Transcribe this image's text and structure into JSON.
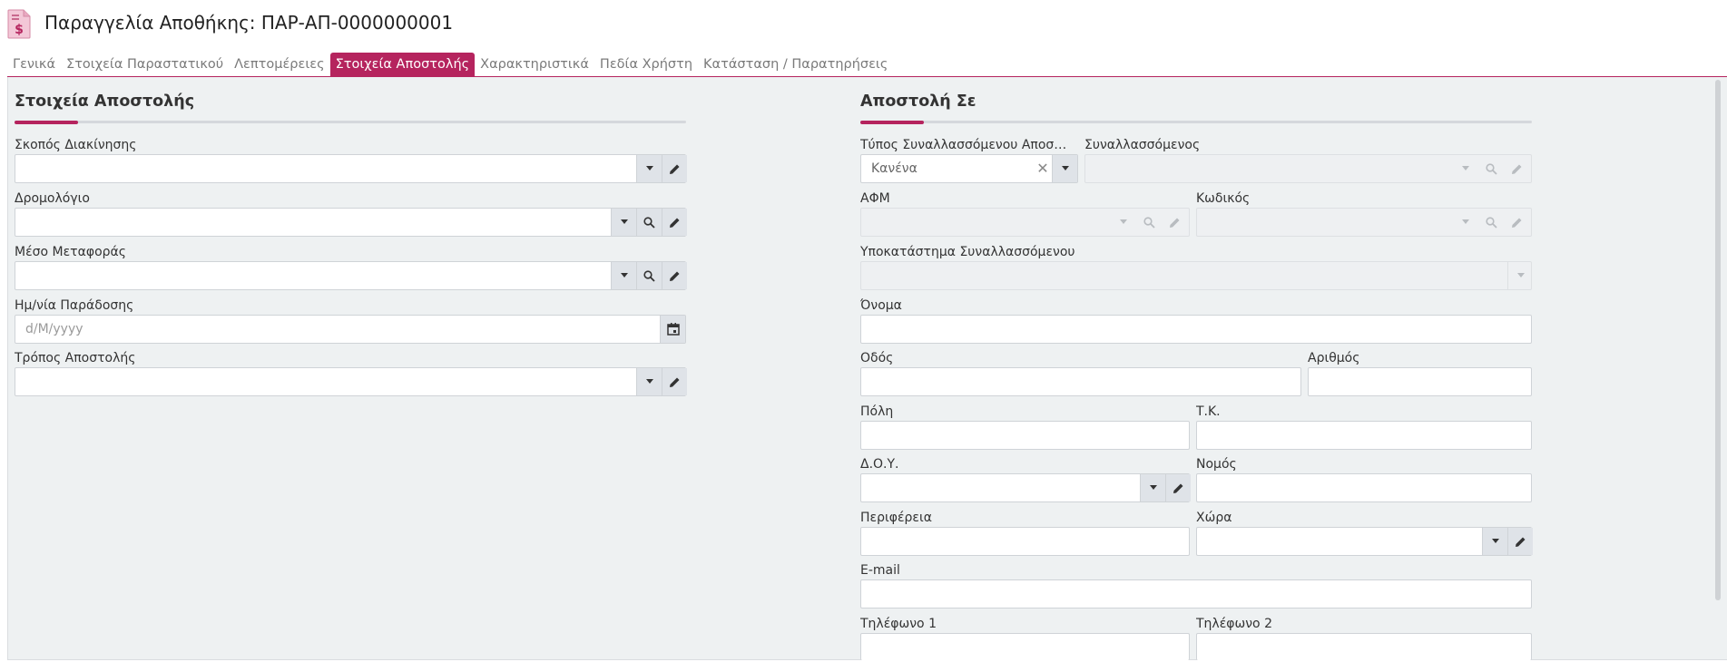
{
  "header": {
    "title": "Παραγγελία Αποθήκης: ΠΑΡ-ΑΠ-0000000001"
  },
  "tabs": [
    {
      "label": "Γενικά",
      "active": false
    },
    {
      "label": "Στοιχεία Παραστατικού",
      "active": false
    },
    {
      "label": "Λεπτομέρειες",
      "active": false
    },
    {
      "label": "Στοιχεία Αποστολής",
      "active": true
    },
    {
      "label": "Χαρακτηριστικά",
      "active": false
    },
    {
      "label": "Πεδία Χρήστη",
      "active": false
    },
    {
      "label": "Κατάσταση / Παρατηρήσεις",
      "active": false
    }
  ],
  "colors": {
    "accent": "#b5245e",
    "panel_bg": "#eef1f2",
    "button_bg": "#dfe3e8"
  },
  "left": {
    "title": "Στοιχεία Αποστολής",
    "movement_purpose": {
      "label": "Σκοπός Διακίνησης",
      "value": ""
    },
    "route": {
      "label": "Δρομολόγιο",
      "value": ""
    },
    "transport": {
      "label": "Μέσο Μεταφοράς",
      "value": ""
    },
    "delivery_date": {
      "label": "Ημ/νία Παράδοσης",
      "placeholder": "d/M/yyyy"
    },
    "shipping_method": {
      "label": "Τρόπος Αποστολής",
      "value": ""
    }
  },
  "right": {
    "title": "Αποστολή Σε",
    "counterparty_type": {
      "label": "Τύπος Συναλλασσόμενου Αποστο...",
      "value": "Κανένα"
    },
    "counterparty": {
      "label": "Συναλλασσόμενος",
      "value": ""
    },
    "vat": {
      "label": "ΑΦΜ",
      "value": ""
    },
    "code": {
      "label": "Κωδικός",
      "value": ""
    },
    "branch": {
      "label": "Υποκατάστημα Συναλλασσόμενου",
      "value": ""
    },
    "name": {
      "label": "Όνομα",
      "value": ""
    },
    "street": {
      "label": "Οδός",
      "value": ""
    },
    "number": {
      "label": "Αριθμός",
      "value": ""
    },
    "city": {
      "label": "Πόλη",
      "value": ""
    },
    "zip": {
      "label": "Τ.Κ.",
      "value": ""
    },
    "tax_office": {
      "label": "Δ.Ο.Υ.",
      "value": ""
    },
    "prefecture": {
      "label": "Νομός",
      "value": ""
    },
    "region": {
      "label": "Περιφέρεια",
      "value": ""
    },
    "country": {
      "label": "Χώρα",
      "value": ""
    },
    "email": {
      "label": "E-mail",
      "value": ""
    },
    "phone1": {
      "label": "Τηλέφωνο 1",
      "value": ""
    },
    "phone2": {
      "label": "Τηλέφωνο 2",
      "value": ""
    }
  }
}
